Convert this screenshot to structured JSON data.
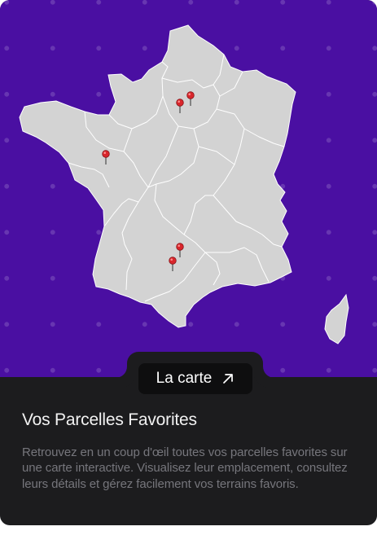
{
  "card": {
    "map": {
      "region": "France",
      "markers": [
        {
          "name": "paris-marker-1",
          "icon": "map-pin-icon",
          "color": "#d9262c"
        },
        {
          "name": "paris-marker-2",
          "icon": "map-pin-icon",
          "color": "#d9262c"
        },
        {
          "name": "nantes-marker",
          "icon": "map-pin-icon",
          "color": "#d9262c"
        },
        {
          "name": "toulouse-marker-1",
          "icon": "map-pin-icon",
          "color": "#d9262c"
        },
        {
          "name": "toulouse-marker-2",
          "icon": "map-pin-icon",
          "color": "#d9262c"
        }
      ]
    },
    "button": {
      "label": "La carte",
      "icon": "arrow-up-right-icon"
    },
    "title": "Vos Parcelles Favorites",
    "description": "Retrouvez en un coup d'œil toutes vos parcelles favorites sur une carte interactive. Visualisez leur emplacement, consultez leurs détails et gérez facilement vos terrains favoris."
  },
  "colors": {
    "map_background": "#4a0fa2",
    "land": "#d3d3d3",
    "card_background": "#1c1c1e",
    "button_background": "#0e0e0f",
    "title_text": "#f2f2f2",
    "description_text": "#76767c",
    "marker": "#d9262c"
  }
}
